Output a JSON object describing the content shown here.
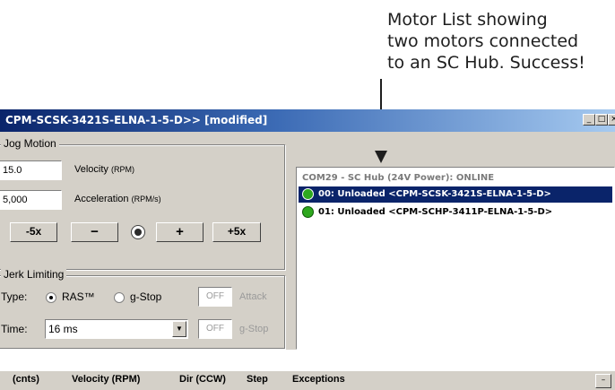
{
  "annotation": {
    "lines": [
      "Motor List showing",
      "two motors connected",
      "to an SC Hub. Success!"
    ]
  },
  "window": {
    "title": "CPM-SCSK-3421S-ELNA-1-5-D>> [modified]",
    "controls": {
      "minimize": "_",
      "restore": "□",
      "close": "×"
    }
  },
  "jog": {
    "title": "Jog Motion",
    "velocity_value": "15.0",
    "velocity_label": "Velocity",
    "velocity_unit": "(RPM)",
    "accel_value": "5,000",
    "accel_label": "Acceleration",
    "accel_unit": "(RPM/s)",
    "buttons": {
      "minus5x": "-5x",
      "minus": "−",
      "plus": "+",
      "plus5x": "+5x"
    },
    "stop_icon": "record-icon"
  },
  "jerk": {
    "title": "Jerk Limiting",
    "type_label": "Type:",
    "ras_label": "RAS™",
    "gstop_label": "g-Stop",
    "ras_selected": true,
    "off1": "OFF",
    "attack_label": "Attack",
    "time_label": "Time:",
    "time_value": "16 ms",
    "off2": "OFF",
    "gstop2_label": "g-Stop"
  },
  "motor_list": {
    "header": "COM29 - SC Hub (24V Power):  ONLINE",
    "motors": [
      {
        "label": "00: Unloaded <CPM-SCSK-3421S-ELNA-1-5-D>",
        "status_color": "#2ea81e",
        "selected": true
      },
      {
        "label": "01: Unloaded <CPM-SCHP-3411P-ELNA-1-5-D>",
        "status_color": "#2ea81e",
        "selected": false
      }
    ]
  },
  "columns": {
    "c1": "(cnts)",
    "c2": "Velocity (RPM)",
    "c3": "Dir (CCW)",
    "c4": "Step",
    "c5": "Exceptions",
    "collapse": "–"
  },
  "colors": {
    "title_gradient_start": "#0a246a",
    "title_gradient_end": "#a6caf0",
    "selection": "#0a246a",
    "status_online": "#2ea81e",
    "face": "#d4d0c8"
  }
}
